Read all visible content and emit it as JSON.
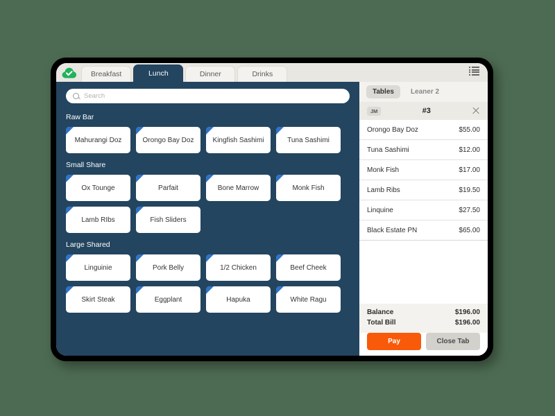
{
  "status": {
    "cloud_icon": "cloud-check-icon"
  },
  "menu_icon": "list-menu-icon",
  "tabs": [
    {
      "label": "Breakfast",
      "active": false
    },
    {
      "label": "Lunch",
      "active": true
    },
    {
      "label": "Dinner",
      "active": false
    },
    {
      "label": "Drinks",
      "active": false
    }
  ],
  "search": {
    "placeholder": "Search",
    "value": "",
    "icon": "search-icon"
  },
  "menu_sections": [
    {
      "label": "Raw Bar",
      "items": [
        "Mahurangi Doz",
        "Orongo Bay Doz",
        "Kingfish Sashimi",
        "Tuna Sashimi"
      ]
    },
    {
      "label": "Small Share",
      "items": [
        "Ox Tounge",
        "Parfait",
        "Bone Marrow",
        "Monk Fish",
        "Lamb RIbs",
        "Fish Sliders"
      ]
    },
    {
      "label": "Large Shared",
      "items": [
        "Linguinie",
        "Pork Belly",
        "1/2 Chicken",
        "Beef Cheek",
        "Skirt Steak",
        "Eggplant",
        "Hapuka",
        "White Ragu"
      ]
    }
  ],
  "order": {
    "tabs": [
      {
        "label": "Tables",
        "selected": true
      },
      {
        "label": "Leaner 2",
        "selected": false
      }
    ],
    "server_initials": "JM",
    "table_number": "#3",
    "close_icon": "close-icon",
    "items": [
      {
        "name": "Orongo Bay Doz",
        "price": "$55.00"
      },
      {
        "name": "Tuna Sashimi",
        "price": "$12.00"
      },
      {
        "name": "Monk Fish",
        "price": "$17.00"
      },
      {
        "name": "Lamb Ribs",
        "price": "$19.50"
      },
      {
        "name": "Linquine",
        "price": "$27.50"
      },
      {
        "name": "Black Estate PN",
        "price": "$65.00"
      }
    ],
    "totals": [
      {
        "label": "Balance",
        "value": "$196.00"
      },
      {
        "label": "Total Bill",
        "value": "$196.00"
      }
    ],
    "pay_label": "Pay",
    "close_tab_label": "Close Tab"
  },
  "colors": {
    "background": "#4d6b52",
    "panel_blue": "#23455f",
    "accent_orange": "#f85a0a",
    "tile_corner_blue": "#2d72c8",
    "cloud_green": "#21b25b"
  }
}
